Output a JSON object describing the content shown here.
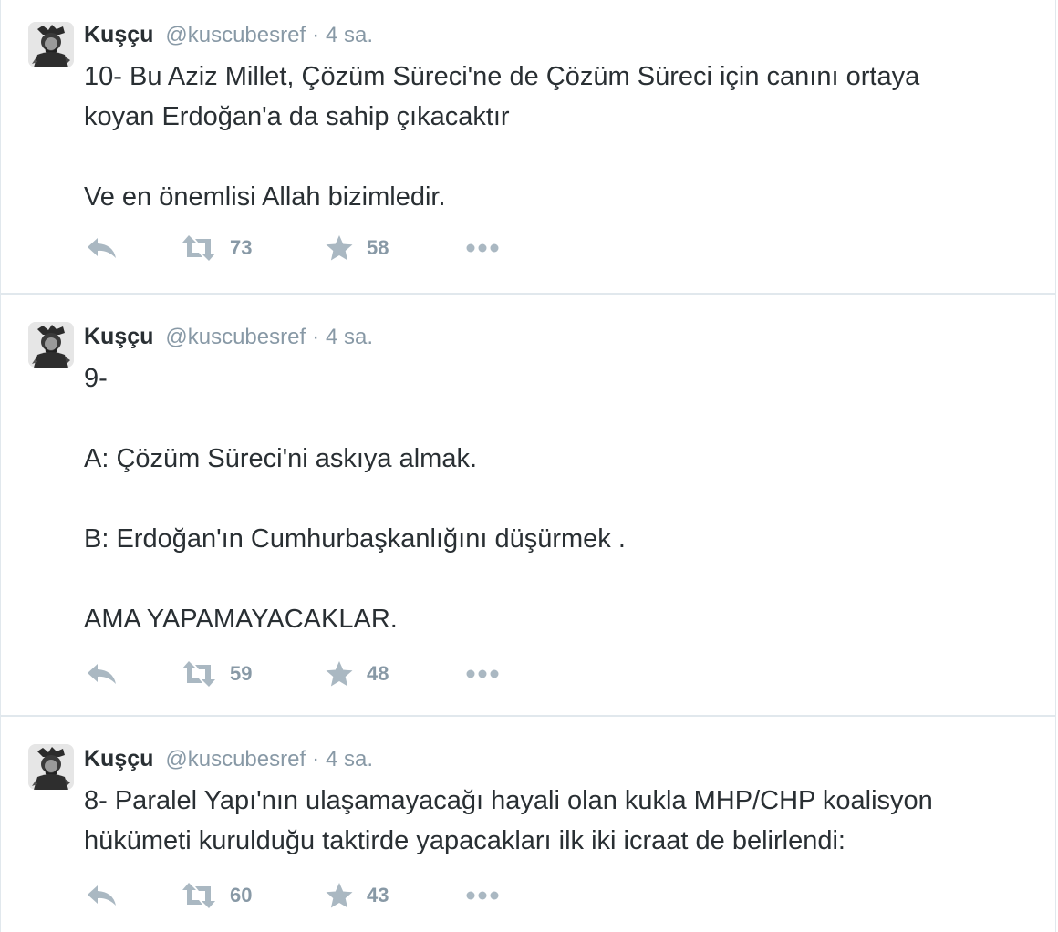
{
  "tweets": [
    {
      "fullname": "Kuşçu",
      "username": "@kuscubesref",
      "separator": "·",
      "time": "4 sa.",
      "lines": [
        "10- Bu Aziz Millet, Çözüm Süreci'ne de Çözüm Süreci için canını ortaya",
        "koyan Erdoğan'a da sahip çıkacaktır",
        "",
        "Ve en önemlisi Allah bizimledir."
      ],
      "retweets": "73",
      "favorites": "58"
    },
    {
      "fullname": "Kuşçu",
      "username": "@kuscubesref",
      "separator": "·",
      "time": "4 sa.",
      "lines": [
        "9-",
        "",
        "A: Çözüm Süreci'ni askıya almak.",
        "",
        "B: Erdoğan'ın Cumhurbaşkanlığını düşürmek .",
        "",
        "AMA YAPAMAYACAKLAR."
      ],
      "retweets": "59",
      "favorites": "48"
    },
    {
      "fullname": "Kuşçu",
      "username": "@kuscubesref",
      "separator": "·",
      "time": "4 sa.",
      "lines": [
        "8- Paralel Yapı'nın ulaşamayacağı hayali olan kukla MHP/CHP koalisyon",
        "hükümeti kurulduğu taktirde yapacakları ilk iki icraat de belirlendi:"
      ],
      "retweets": "60",
      "favorites": "43"
    }
  ],
  "icons": {
    "reply": "reply-icon",
    "retweet": "retweet-icon",
    "favorite": "star-icon",
    "more": "more-dots-icon"
  },
  "colors": {
    "name": "#292f33",
    "meta": "#8899a6",
    "icon": "#aab8c2",
    "border": "#e1e8ed"
  }
}
